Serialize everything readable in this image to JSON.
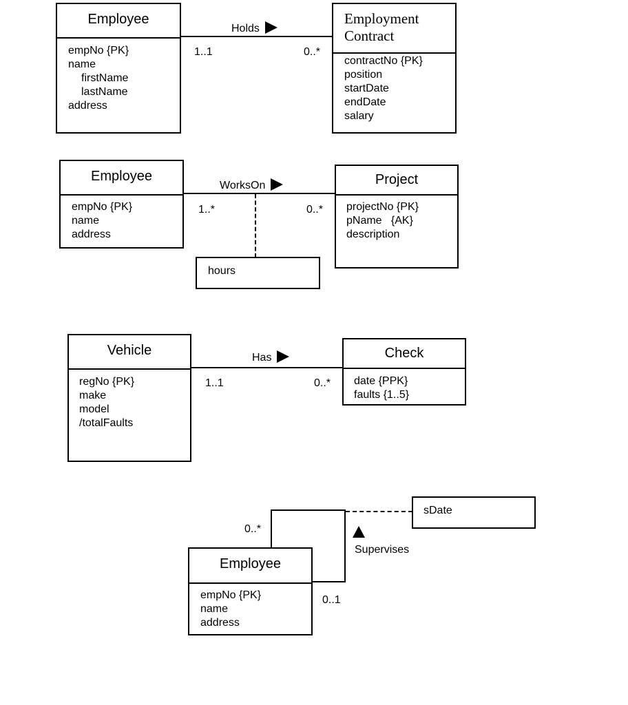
{
  "diagram1": {
    "left": {
      "name": "Employee",
      "attributes": [
        "empNo {PK}",
        "name",
        "firstName",
        "lastName",
        "address"
      ]
    },
    "right": {
      "name_line1": "Employment",
      "name_line2": "Contract",
      "attributes": [
        "contractNo {PK}",
        "position",
        "startDate",
        "endDate",
        "salary"
      ]
    },
    "association": {
      "label": "Holds",
      "direction": "right",
      "left_multiplicity": "1..1",
      "right_multiplicity": "0..*"
    }
  },
  "diagram2": {
    "left": {
      "name": "Employee",
      "attributes": [
        "empNo {PK}",
        "name",
        "address"
      ]
    },
    "right": {
      "name": "Project",
      "attributes": [
        "projectNo {PK}",
        "pName   {AK}",
        "description"
      ]
    },
    "association": {
      "label": "WorksOn",
      "direction": "right",
      "left_multiplicity": "1..*",
      "right_multiplicity": "0..*"
    },
    "association_class": {
      "attributes": [
        "hours"
      ]
    }
  },
  "diagram3": {
    "left": {
      "name": "Vehicle",
      "attributes": [
        "regNo {PK}",
        "make",
        "model",
        "/totalFaults"
      ]
    },
    "right": {
      "name": "Check",
      "attributes": [
        "date {PPK}",
        "faults {1..5}"
      ]
    },
    "association": {
      "label": "Has",
      "direction": "right",
      "left_multiplicity": "1..1",
      "right_multiplicity": "0..*"
    }
  },
  "diagram4": {
    "entity": {
      "name": "Employee",
      "attributes": [
        "empNo {PK}",
        "name",
        "address"
      ]
    },
    "association": {
      "label": "Supervises",
      "direction": "up",
      "top_multiplicity": "0..*",
      "bottom_multiplicity": "0..1"
    },
    "association_class": {
      "attributes": [
        "sDate"
      ]
    }
  }
}
